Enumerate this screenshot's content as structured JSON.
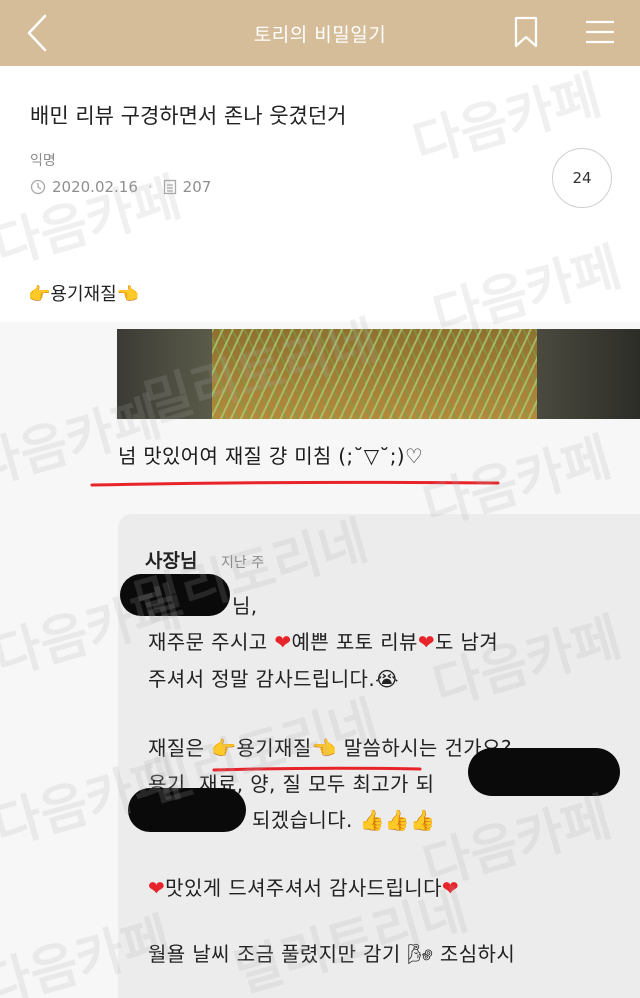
{
  "header": {
    "title": "토리의 비밀일기",
    "back_icon": "chevron-left-icon",
    "bookmark_icon": "bookmark-icon",
    "menu_icon": "hamburger-menu-icon",
    "background": "#d6bd99"
  },
  "post": {
    "title": "배민 리뷰 구경하면서 존나 웃겼던거",
    "author": "익명",
    "date": "2020.02.16",
    "views": "207",
    "comment_count": "24",
    "heading": "👉용기재질👈"
  },
  "screenshot": {
    "review_text": "넘 맛있어여 재질 걍 미침 (;˘▽˘;)♡",
    "reply": {
      "author": "사장님",
      "time": "지난 주",
      "line1": "님,",
      "line2a": "재주문 주시고 ",
      "line2b": "예쁜 포토 리뷰",
      "line2c": "도 남겨",
      "line3": "주셔서 정말 감사드립니다.😭",
      "line4a": "재질은 👉용기재질👈 말씀하시는 건가요?",
      "line5": "용기, 재료, 양, 질 모두 최고가 되",
      "line6": "되겠습니다. 👍👍👍",
      "line7": "맛있게 드셔주셔서 감사드립니다",
      "line8": "월욜 날씨 조금 풀렸지만  감기 🌬 조심하시",
      "line9": ""
    }
  },
  "watermark": {
    "text1": "다음카페",
    "text2": "밀리토리네"
  },
  "colors": {
    "accent_red": "#e8242b",
    "header_beige": "#d6bd99"
  }
}
